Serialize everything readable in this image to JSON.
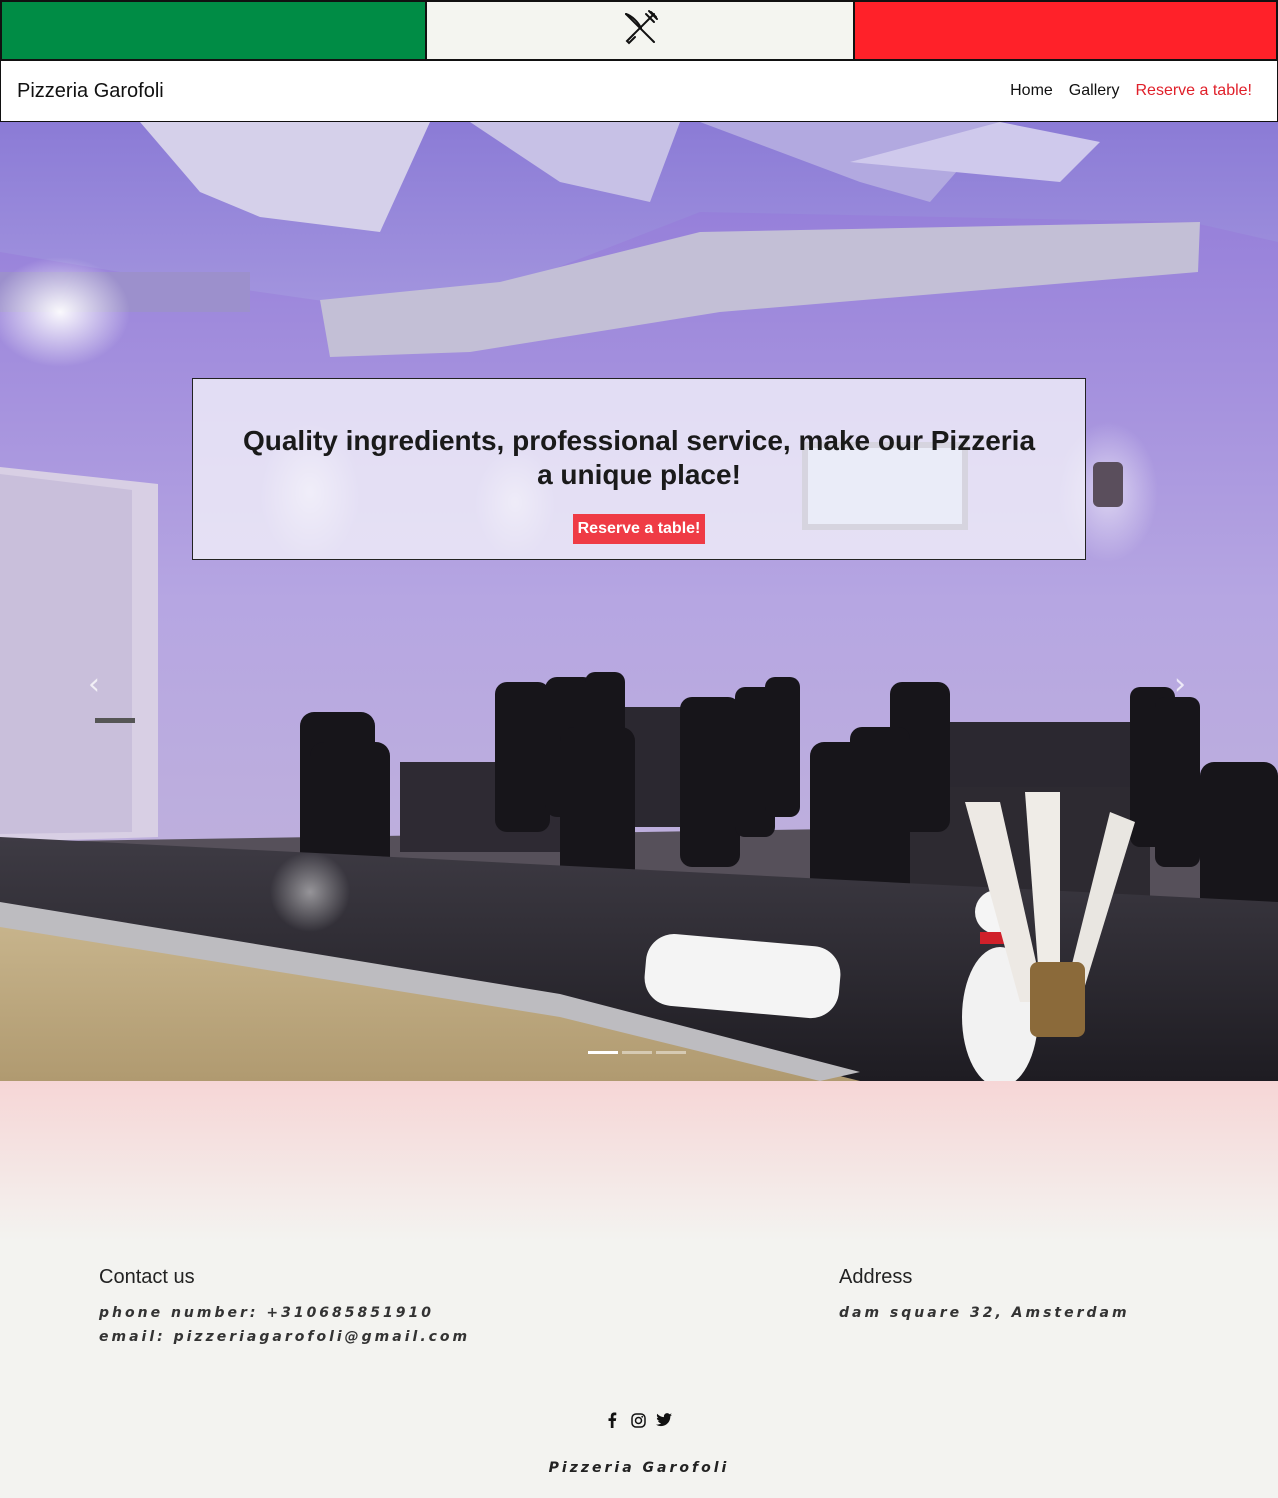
{
  "brand": {
    "name": "Pizzeria Garofoli"
  },
  "flag_colors": {
    "green": "#008c45",
    "white": "#f4f5f0",
    "red": "#ff2129"
  },
  "nav": {
    "home": "Home",
    "gallery": "Gallery",
    "reserve": "Reserve a table!"
  },
  "hero": {
    "headline": "Quality ingredients, professional service, make our Pizzeria a unique place!",
    "button": "Reserve a table!",
    "prev_icon": "chevron-left-icon",
    "next_icon": "chevron-right-icon",
    "slides_count_shown": 3,
    "active_slide": 1
  },
  "footer": {
    "contact_heading": "Contact us",
    "phone": "phone number: +310685851910",
    "email": "email: pizzeriagarofoli@gmail.com",
    "address_heading": "Address",
    "address": "dam square 32, Amsterdam",
    "socials": [
      "facebook-icon",
      "instagram-icon",
      "twitter-icon"
    ],
    "brand": "Pizzeria Garofoli"
  },
  "colors": {
    "accent": "#e0202a",
    "button": "#ef3b45"
  }
}
